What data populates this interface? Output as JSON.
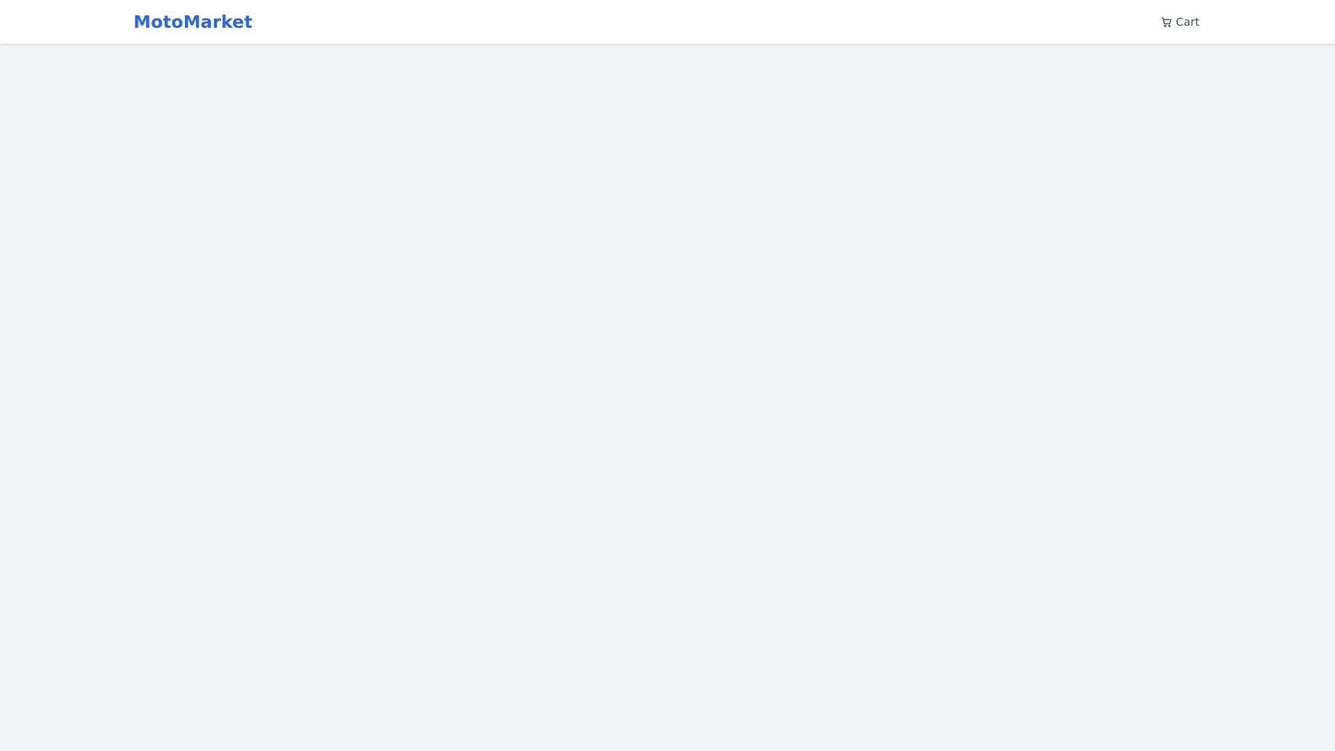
{
  "header": {
    "brand": "MotoMarket",
    "cart_label": "Cart",
    "cart_icon": "shopping-cart-icon"
  },
  "colors": {
    "brand": "#2b67dd",
    "header_bg": "#ffffff",
    "page_bg": "#f2f3f5",
    "nav_text": "#4b5563"
  }
}
